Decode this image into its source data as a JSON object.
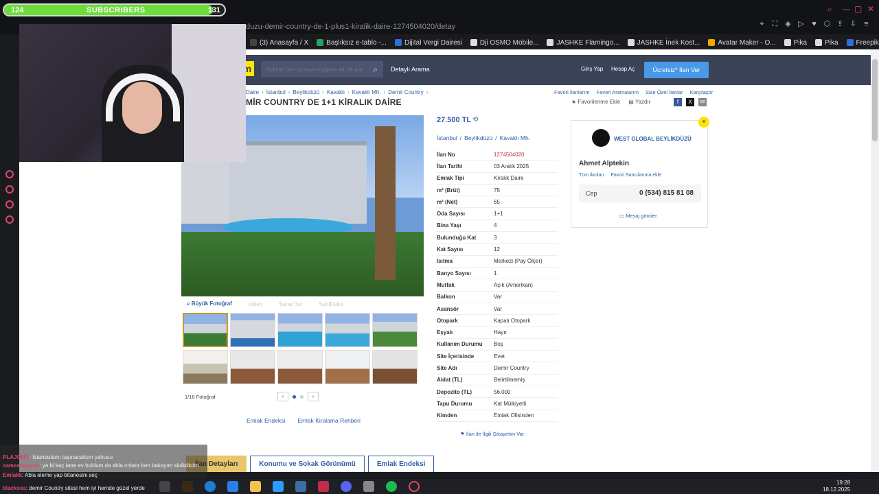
{
  "overlay": {
    "sub_count": "124",
    "sub_title": "SUBSCRIBERS",
    "sub_goal": "131",
    "sub_progress": 0.946
  },
  "browser": {
    "url": "ilan/emlak-kiralik-daire-beylikduzu-demir-country-de-1-plus1-kiralik-daire-1274504020/detay",
    "url_visible": "duzu-demir-country-de-1-plus1-kiralik-daire-1274504020/detay",
    "bookmarks": [
      {
        "label": "(3) Anasayfa / X",
        "color": "#444444"
      },
      {
        "label": "Başlıksız e-tablo -...",
        "color": "#23a566"
      },
      {
        "label": "Dijital Vergi Dairesi",
        "color": "#2e6fd8"
      },
      {
        "label": "Dji OSMO Mobile...",
        "color": "#dddddd"
      },
      {
        "label": "JASHKE Flamingo...",
        "color": "#dddddd"
      },
      {
        "label": "JASHKE İnek Kost...",
        "color": "#dddddd"
      },
      {
        "label": "Avatar Maker - O...",
        "color": "#f2a800"
      },
      {
        "label": "Pika",
        "color": "#dddddd"
      },
      {
        "label": "Pika",
        "color": "#dddddd"
      },
      {
        "label": "Freepik Sketch - F...",
        "color": "#2e6fd8"
      }
    ]
  },
  "site": {
    "logo": "m",
    "search_placeholder": "Kelime, ilan no veya mağaza adı ile ara",
    "detailed_search": "Detaylı Arama",
    "login": "Giriş Yap",
    "signup": "Hesap Aç",
    "post_ad": "Ücretsiz* İlan Ver",
    "breadcrumbs": [
      "Daire",
      "İstanbul",
      "Beylikdüzü",
      "Kavaklı",
      "Kavaklı Mh.",
      "Demir Country"
    ],
    "fav_links": [
      "Favori İlanlarım",
      "Favori Aramalarım",
      "Size Özel İlanlar",
      "Karşılaştır"
    ]
  },
  "listing": {
    "title": "MİR COUNTRY DE 1+1 KİRALIK DAİRE",
    "add_fav": "Favorilerime Ekle",
    "print": "Yazdır",
    "price": "27.500 TL",
    "location": [
      "İstanbul",
      "Beylikdüzü",
      "Kavaklı Mh."
    ],
    "gallery_tabs": [
      "Büyük Fotoğraf",
      "Video",
      "Sanal Tur",
      "SahiDeko"
    ],
    "photo_count": "1/16 Fotoğraf",
    "left_links": [
      "Emlak Endeksi",
      "Emlak Kiralama Rehberi"
    ],
    "complaint": "İlan ile İlgili Şikayetim Var",
    "info": [
      {
        "k": "İlan No",
        "v": "1274504020"
      },
      {
        "k": "İlan Tarihi",
        "v": "03 Aralık 2025"
      },
      {
        "k": "Emlak Tipi",
        "v": "Kiralık Daire"
      },
      {
        "k": "m² (Brüt)",
        "v": "75"
      },
      {
        "k": "m² (Net)",
        "v": "65"
      },
      {
        "k": "Oda Sayısı",
        "v": "1+1"
      },
      {
        "k": "Bina Yaşı",
        "v": "4"
      },
      {
        "k": "Bulunduğu Kat",
        "v": "3"
      },
      {
        "k": "Kat Sayısı",
        "v": "12"
      },
      {
        "k": "Isıtma",
        "v": "Merkezi (Pay Ölçer)"
      },
      {
        "k": "Banyo Sayısı",
        "v": "1"
      },
      {
        "k": "Mutfak",
        "v": "Açık (Amerikan)"
      },
      {
        "k": "Balkon",
        "v": "Var"
      },
      {
        "k": "Asansör",
        "v": "Var"
      },
      {
        "k": "Otopark",
        "v": "Kapalı Otopark"
      },
      {
        "k": "Eşyalı",
        "v": "Hayır"
      },
      {
        "k": "Kullanım Durumu",
        "v": "Boş"
      },
      {
        "k": "Site İçerisinde",
        "v": "Evet"
      },
      {
        "k": "Site Adı",
        "v": "Demir Country"
      },
      {
        "k": "Aidat (TL)",
        "v": "Belirtilmemiş"
      },
      {
        "k": "Depozito (TL)",
        "v": "56.000"
      },
      {
        "k": "Tapu Durumu",
        "v": "Kat Mülkiyetli"
      },
      {
        "k": "Kimden",
        "v": "Emlak Ofisinden"
      }
    ]
  },
  "seller": {
    "name": "WEST GLOBAL BEYLİKDÜZÜ",
    "agent": "Ahmet Alptekin",
    "all_ads": "Tüm ilanları",
    "fav_seller": "Favori Satıcılarıma ekle",
    "phone_label": "Cep",
    "phone": "0 (534) 815 81 08",
    "message": "Mesaj gönder"
  },
  "bottom_tabs": [
    "İlan Detayları",
    "Konumu ve Sokak Görünümü",
    "Emlak Endeksi"
  ],
  "chat": [
    {
      "user": "PLAJONG",
      "msg": ": İstanbulamı taşınacaksın yahuuu"
    },
    {
      "user": "samsetappam",
      "msg": ": ya bi kaç tane ev buldum da abla onlara ben bakayım skdkdkdm"
    },
    {
      "user": "Emlakk",
      "msg": ": Abla eleme yap bitanesini seç"
    },
    {
      "user": "blacksea",
      "msg": ": demir Country sitesi hem iyi hemde güzel yerde"
    }
  ],
  "clock": {
    "time": "19:28",
    "date": "18.12.2025"
  }
}
